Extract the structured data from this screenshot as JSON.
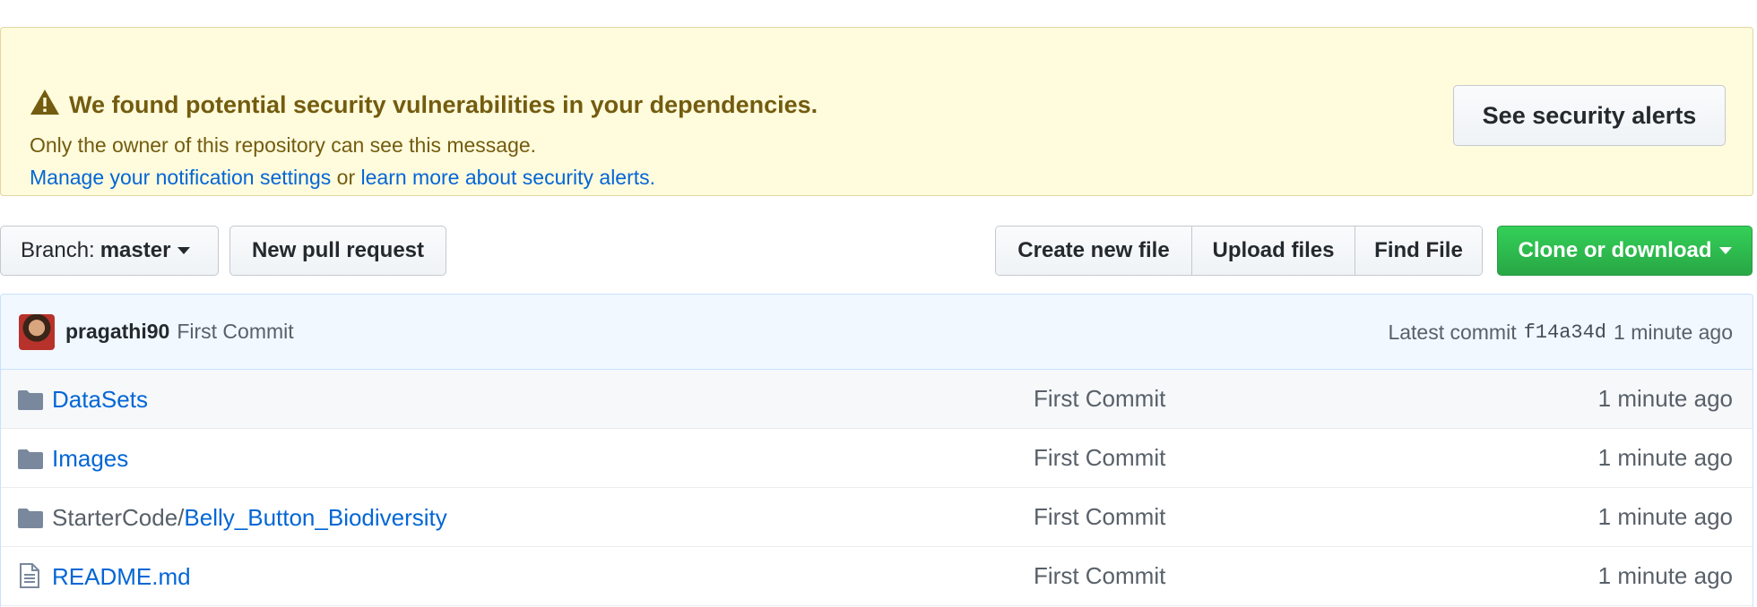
{
  "alert": {
    "title": "We found potential security vulnerabilities in your dependencies.",
    "message": "Only the owner of this repository can see this message.",
    "link_manage": "Manage your notification settings",
    "connector": " or ",
    "link_learn": "learn more about security alerts.",
    "button": "See security alerts",
    "icon": "alert-icon"
  },
  "nav": {
    "branch_prefix": "Branch:",
    "branch_name": "master",
    "new_pr": "New pull request",
    "create_file": "Create new file",
    "upload_files": "Upload files",
    "find_file": "Find File",
    "clone": "Clone or download"
  },
  "commit": {
    "author": "pragathi90",
    "message": "First Commit",
    "latest_label": "Latest commit",
    "sha": "f14a34d",
    "age": "1 minute ago"
  },
  "files": [
    {
      "type": "folder",
      "prefix": "",
      "name": "DataSets",
      "message": "First Commit",
      "age": "1 minute ago"
    },
    {
      "type": "folder",
      "prefix": "",
      "name": "Images",
      "message": "First Commit",
      "age": "1 minute ago"
    },
    {
      "type": "folder",
      "prefix": "StarterCode/",
      "name": "Belly_Button_Biodiversity",
      "message": "First Commit",
      "age": "1 minute ago"
    },
    {
      "type": "file",
      "prefix": "",
      "name": "README.md",
      "message": "First Commit",
      "age": "1 minute ago"
    }
  ],
  "colors": {
    "alert_bg": "#fffbdd",
    "alert_text": "#735c0f",
    "link": "#0366d6",
    "clone_green": "#28a745",
    "commit_bg": "#f1f8ff"
  }
}
